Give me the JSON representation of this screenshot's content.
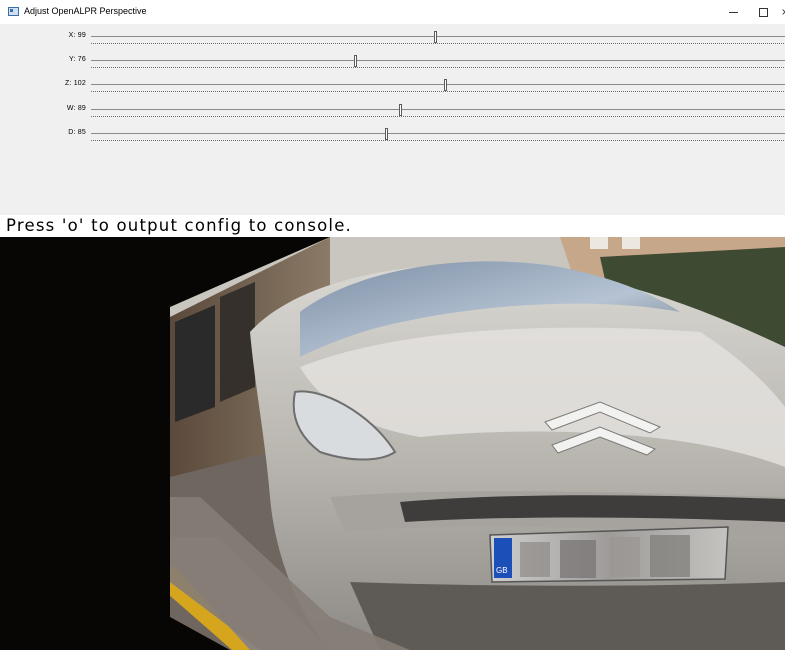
{
  "window": {
    "title": "Adjust OpenALPR Perspective",
    "minimize_icon": "minimize-icon",
    "maximize_icon": "maximize-icon",
    "close_label": "×"
  },
  "sliders": [
    {
      "label": "X: 99",
      "value": 99
    },
    {
      "label": "Y: 76",
      "value": 76
    },
    {
      "label": "Z: 102",
      "value": 102
    },
    {
      "label": "W: 89",
      "value": 89
    },
    {
      "label": "D: 85",
      "value": 85
    }
  ],
  "status_text": "Press 'o' to output config to console.",
  "image": {
    "description_icon": "warped-car-photo",
    "plate_badge": "GB"
  }
}
